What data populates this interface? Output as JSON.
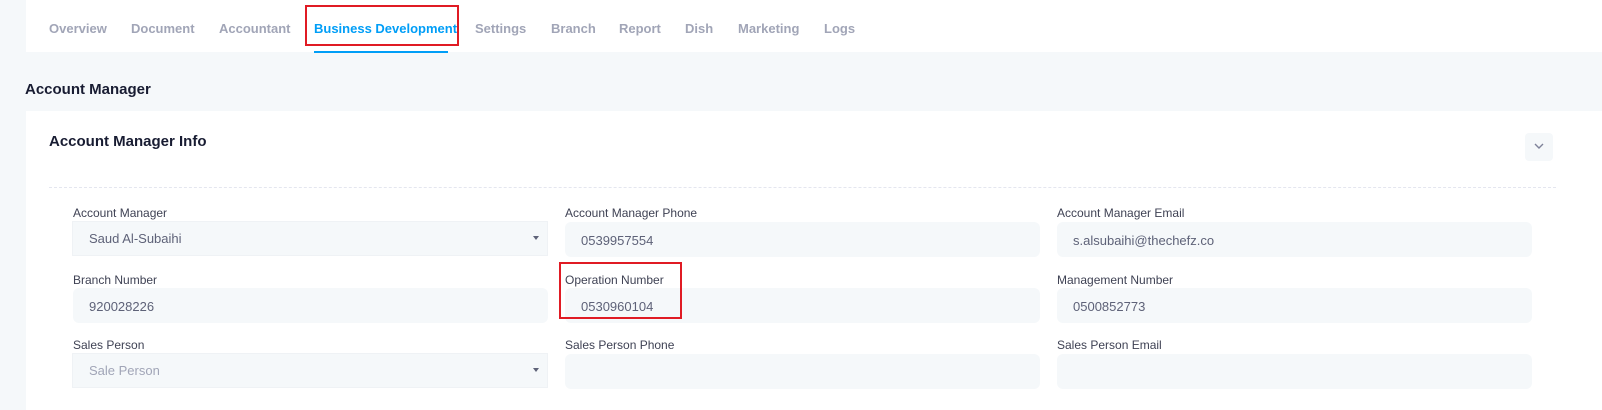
{
  "tabs": [
    {
      "label": "Overview"
    },
    {
      "label": "Document"
    },
    {
      "label": "Accountant"
    },
    {
      "label": "Business Development"
    },
    {
      "label": "Settings"
    },
    {
      "label": "Branch"
    },
    {
      "label": "Report"
    },
    {
      "label": "Dish"
    },
    {
      "label": "Marketing"
    },
    {
      "label": "Logs"
    }
  ],
  "active_tab": "Business Development",
  "section_title": "Account Manager",
  "card": {
    "title": "Account Manager Info",
    "collapse_icon": "chevron-down-icon"
  },
  "fields": {
    "account_manager": {
      "label": "Account Manager",
      "value": "Saud Al-Subaihi"
    },
    "account_manager_phone": {
      "label": "Account Manager Phone",
      "value": "0539957554"
    },
    "account_manager_email": {
      "label": "Account Manager Email",
      "value": "s.alsubaihi@thechefz.co"
    },
    "branch_number": {
      "label": "Branch Number",
      "value": "920028226"
    },
    "operation_number": {
      "label": "Operation Number",
      "value": "0530960104"
    },
    "management_number": {
      "label": "Management Number",
      "value": "0500852773"
    },
    "sales_person": {
      "label": "Sales Person",
      "placeholder": "Sale Person"
    },
    "sales_person_phone": {
      "label": "Sales Person Phone",
      "value": ""
    },
    "sales_person_email": {
      "label": "Sales Person Email",
      "value": ""
    }
  },
  "colors": {
    "accent": "#009ef7",
    "highlight": "#e01b24",
    "background": "#f5f8fa"
  }
}
